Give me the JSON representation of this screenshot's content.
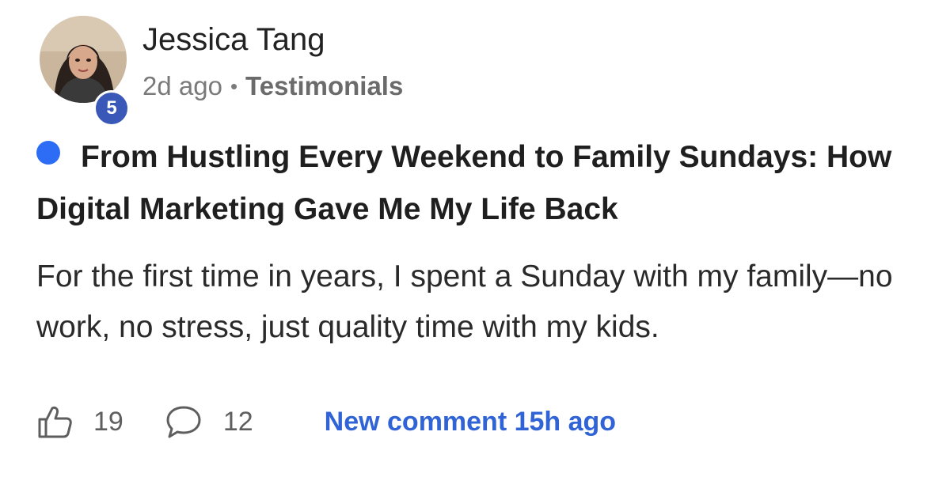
{
  "post": {
    "author": {
      "name": "Jessica Tang",
      "level": "5"
    },
    "meta": {
      "time": "2d ago",
      "separator": "•",
      "category": "Testimonials"
    },
    "title": "From Hustling Every Weekend to Family Sundays: How Digital Marketing Gave Me My Life Back",
    "body": "For the first time in years, I spent a Sunday with my family—no work, no stress, just quality time with my kids.",
    "unread_color": "#2d6df5",
    "footer": {
      "likes": "19",
      "comments": "12",
      "new_comment": "New comment 15h ago"
    },
    "colors": {
      "badge": "#3a58b8",
      "link": "#2f63d6"
    },
    "icons": {
      "like": "thumbs-up-icon",
      "comment": "comment-bubble-icon"
    }
  }
}
